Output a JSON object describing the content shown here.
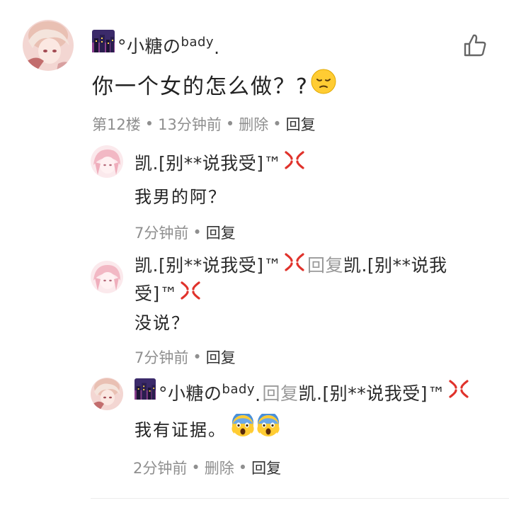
{
  "main": {
    "author_name": "°小糖の",
    "author_badge": "bady",
    "author_suffix": ".",
    "content": "你一个女的怎么做？?",
    "floor": "第12楼",
    "time": "13分钟前",
    "delete_label": "删除",
    "reply_label": "回复"
  },
  "replies": [
    {
      "author": "凯.[别**说我受]™",
      "content": "我男的阿？",
      "time": "7分钟前",
      "reply_label": "回复"
    },
    {
      "author": "凯.[别**说我受]™",
      "reply_word": "回复",
      "target_line1": "凯.[别**说我",
      "target_line2": "受]™",
      "content": "没说？",
      "time": "7分钟前",
      "reply_label": "回复"
    },
    {
      "author_name": "°小糖の",
      "author_badge": "bady",
      "author_suffix": ".",
      "reply_word": "回复",
      "target": "凯.[别**说我受]™",
      "content": "我有证据。",
      "time": "2分钟前",
      "delete_label": "删除",
      "reply_label": "回复"
    }
  ],
  "colors": {
    "meta_text": "#8f8f8f",
    "action_text": "#333333",
    "anger_symbol": "#e0322b"
  },
  "icons": [
    "thumbs-up-icon",
    "city-night-icon",
    "pensive-face-icon",
    "anger-symbol-icon",
    "fearful-face-icon"
  ]
}
